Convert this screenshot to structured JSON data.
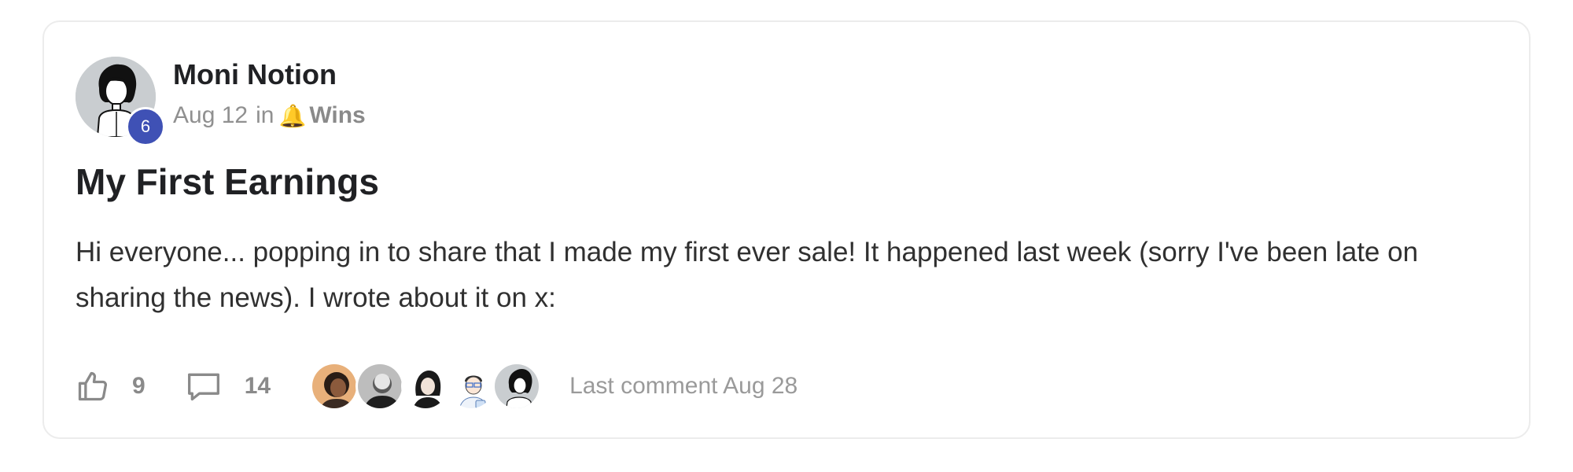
{
  "post": {
    "author": {
      "name": "Moni Notion",
      "level": "6"
    },
    "meta": {
      "date": "Aug 12",
      "in_text": "in",
      "category_emoji": "🔔",
      "category": "Wins"
    },
    "title": "My First Earnings",
    "body": "Hi everyone... popping in to share that I made my first ever sale! It happened last week (sorry I've been late on sharing the news). I wrote about it on x:",
    "likes": "9",
    "comments": "14",
    "last_comment": "Last comment Aug 28",
    "commenter_avatars": [
      "avatar-1",
      "avatar-2",
      "avatar-3",
      "avatar-4",
      "avatar-5"
    ]
  },
  "icons": {
    "like": "thumbs-up-icon",
    "comment": "comment-bubble-icon"
  },
  "colors": {
    "level_badge": "#3f51b5",
    "muted_text": "#909090",
    "title_text": "#202124",
    "card_border": "#ececec"
  }
}
